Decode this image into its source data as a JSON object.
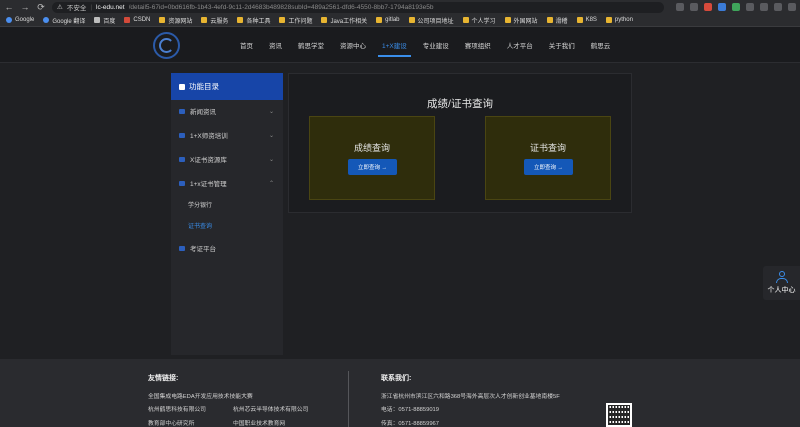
{
  "browser": {
    "security_label": "不安全",
    "url_host": "lc-edu.net",
    "url_rest": "/detail5-67id=0bd616fb-1b43-4efd-9c11-2d4683b489828subId=489a2561-dfd6-4550-8bb7-1794a8193e5b",
    "bookmarks": [
      "Google",
      "Google 翻译",
      "百度",
      "CSDN",
      "资源网站",
      "云服务",
      "各种工具",
      "工作问题",
      "Java工作相关",
      "gitlab",
      "公司项目地址",
      "个人学习",
      "外国网站",
      "滑稽",
      "K8S",
      "python"
    ]
  },
  "nav": {
    "items": [
      "首页",
      "资讯",
      "鹤思学堂",
      "资源中心",
      "1+X建设",
      "专业建设",
      "赛项组织",
      "人才平台",
      "关于我们",
      "鹤思云"
    ],
    "active_index": 4
  },
  "sidebar": {
    "title": "功能目录",
    "items": [
      "新闻资讯",
      "1+X师资培训",
      "X证书资源库",
      "1+x证书管理"
    ],
    "sub_items": [
      "学分银行",
      "证书查询"
    ],
    "active_sub_index": 1,
    "last_item": "考证平台"
  },
  "panel": {
    "title": "成绩/证书查询",
    "cards": [
      {
        "title": "成绩查询",
        "button": "立即查询 →"
      },
      {
        "title": "证书查询",
        "button": "立即查询 →"
      }
    ]
  },
  "personal_center": "个人中心",
  "footer": {
    "links_title": "友情链接:",
    "links": [
      "全国集成电路EDA开发应用技术技能大赛",
      "杭州鹤思科技有限公司",
      "杭州芯云半导体技术有限公司",
      "教育部中心研究所",
      "中国职业技术教育网"
    ],
    "contact_title": "联系我们:",
    "address": "浙江省杭州市滨江区六和路368号海外高层次人才创新创业基地南楼5F",
    "phone": "电话：0571-88859019",
    "fax": "传真：0571-88859967"
  },
  "colors": {
    "accent": "#3a8eea",
    "primary": "#1458b8",
    "sidebar_head": "#1745a8",
    "card_bg": "#2f2d0c"
  }
}
